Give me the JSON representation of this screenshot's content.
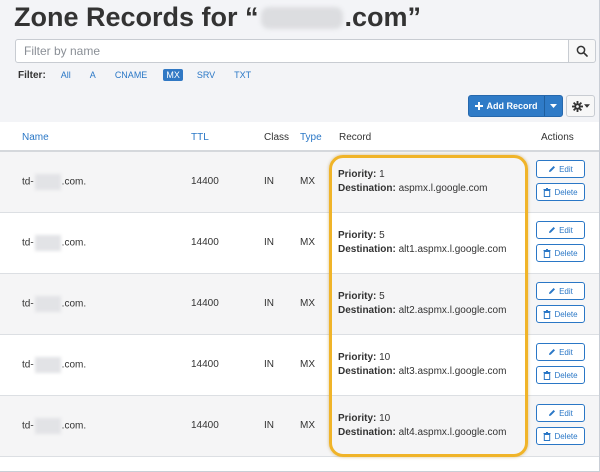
{
  "page": {
    "title_prefix": "Zone Records for “",
    "title_suffix": ".com”"
  },
  "search": {
    "placeholder": "Filter by name",
    "value": ""
  },
  "filter": {
    "label": "Filter:",
    "options": [
      "All",
      "A",
      "CNAME",
      "MX",
      "SRV",
      "TXT"
    ],
    "active": "MX"
  },
  "toolbar": {
    "add_record_label": "Add Record"
  },
  "table": {
    "headers": {
      "name": "Name",
      "ttl": "TTL",
      "class": "Class",
      "type": "Type",
      "record": "Record",
      "actions": "Actions"
    },
    "rows": [
      {
        "name_prefix": "td-",
        "name_suffix": ".com.",
        "ttl": "14400",
        "class": "IN",
        "type": "MX",
        "priority_label": "Priority:",
        "priority": "1",
        "destination_label": "Destination:",
        "destination": "aspmx.l.google.com"
      },
      {
        "name_prefix": "td-",
        "name_suffix": ".com.",
        "ttl": "14400",
        "class": "IN",
        "type": "MX",
        "priority_label": "Priority:",
        "priority": "5",
        "destination_label": "Destination:",
        "destination": "alt1.aspmx.l.google.com"
      },
      {
        "name_prefix": "td-",
        "name_suffix": ".com.",
        "ttl": "14400",
        "class": "IN",
        "type": "MX",
        "priority_label": "Priority:",
        "priority": "5",
        "destination_label": "Destination:",
        "destination": "alt2.aspmx.l.google.com"
      },
      {
        "name_prefix": "td-",
        "name_suffix": ".com.",
        "ttl": "14400",
        "class": "IN",
        "type": "MX",
        "priority_label": "Priority:",
        "priority": "10",
        "destination_label": "Destination:",
        "destination": "alt3.aspmx.l.google.com"
      },
      {
        "name_prefix": "td-",
        "name_suffix": ".com.",
        "ttl": "14400",
        "class": "IN",
        "type": "MX",
        "priority_label": "Priority:",
        "priority": "10",
        "destination_label": "Destination:",
        "destination": "alt4.aspmx.l.google.com"
      }
    ],
    "edit_label": "Edit",
    "delete_label": "Delete"
  },
  "colors": {
    "accent": "#2f7bc7",
    "link": "#2a77c6",
    "highlight": "#f0b429"
  },
  "icons": {
    "search": "search-icon",
    "add": "plus-icon",
    "dropdown": "caret-down-icon",
    "settings": "gear-icon",
    "edit": "pencil-icon",
    "delete": "trash-icon"
  }
}
